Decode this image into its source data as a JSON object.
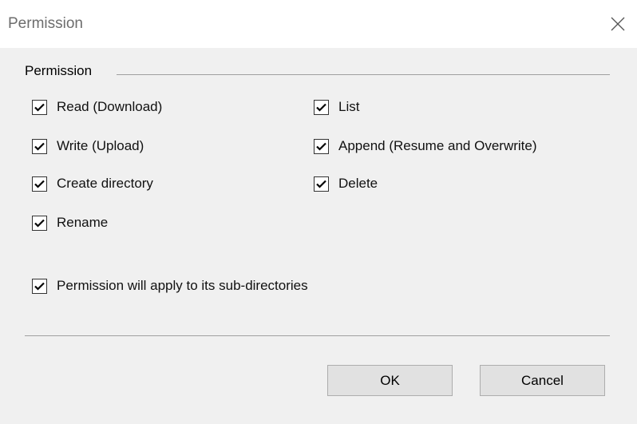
{
  "window": {
    "title": "Permission",
    "close_icon": "close-icon"
  },
  "group": {
    "label": "Permission",
    "checkboxes": [
      {
        "label": "Read (Download)",
        "checked": true
      },
      {
        "label": "List",
        "checked": true
      },
      {
        "label": "Write (Upload)",
        "checked": true
      },
      {
        "label": "Append (Resume and Overwrite)",
        "checked": true
      },
      {
        "label": "Create directory",
        "checked": true
      },
      {
        "label": "Delete",
        "checked": true
      },
      {
        "label": "Rename",
        "checked": true
      }
    ]
  },
  "apply_subdirs": {
    "label": "Permission will apply to its sub-directories",
    "checked": true
  },
  "buttons": {
    "ok": "OK",
    "cancel": "Cancel"
  }
}
